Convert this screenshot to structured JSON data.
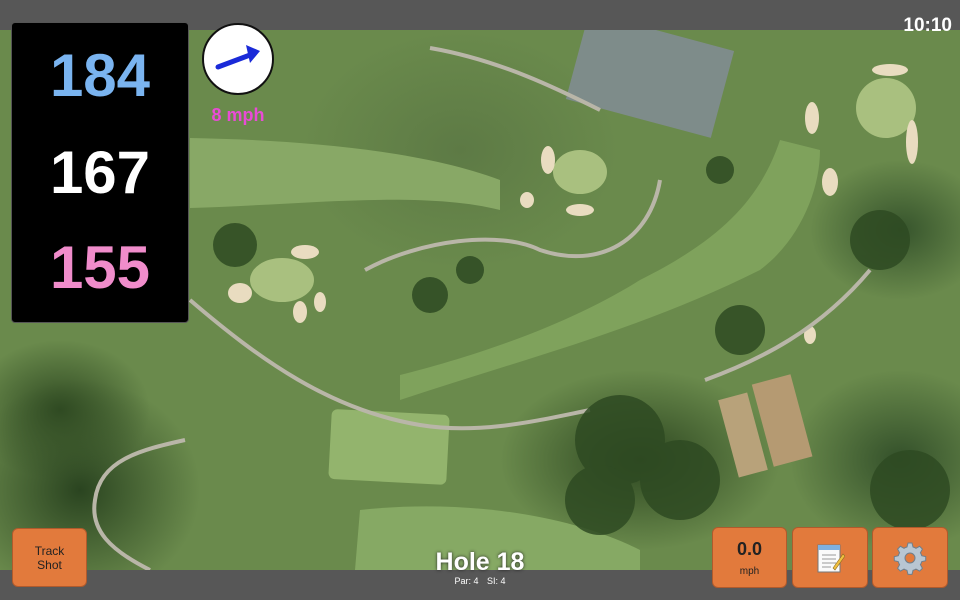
{
  "status_bar": {
    "time": "10:10"
  },
  "distances": {
    "back": "184",
    "middle": "167",
    "front": "155"
  },
  "wind": {
    "speed": "8 mph",
    "icon": "wind-arrow-icon"
  },
  "buttons": {
    "track_shot_line1": "Track",
    "track_shot_line2": "Shot",
    "speed_value": "0.0",
    "speed_unit": "mph",
    "notes_icon": "notepad-icon",
    "settings_icon": "gear-icon"
  },
  "hole": {
    "title": "Hole 18",
    "par": "Par: 4",
    "si": "SI: 4"
  },
  "colors": {
    "back_distance": "#7ab4f0",
    "middle_distance": "#ffffff",
    "front_distance": "#f08ccb",
    "wind_text": "#e94bd6",
    "button_orange": "#e27a3c"
  }
}
